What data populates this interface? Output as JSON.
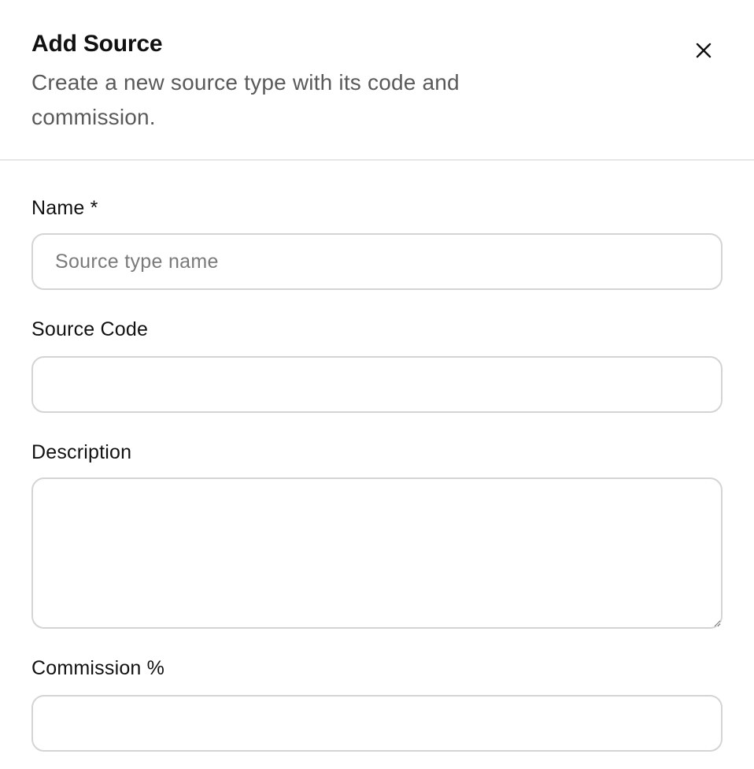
{
  "dialog": {
    "title": "Add Source",
    "subtitle": "Create a new source type with its code and commission.",
    "close_icon": "close-icon"
  },
  "form": {
    "name": {
      "label": "Name *",
      "value": "",
      "placeholder": "Source type name"
    },
    "source_code": {
      "label": "Source Code",
      "value": "",
      "placeholder": ""
    },
    "description": {
      "label": "Description",
      "value": "",
      "placeholder": ""
    },
    "commission": {
      "label": "Commission %",
      "value": "",
      "placeholder": ""
    }
  },
  "colors": {
    "text_primary": "#111111",
    "text_secondary": "#5a5a5a",
    "placeholder": "#7a7a7a",
    "border": "#d4d4d4",
    "divider": "#e7e7e7",
    "background": "#ffffff"
  }
}
